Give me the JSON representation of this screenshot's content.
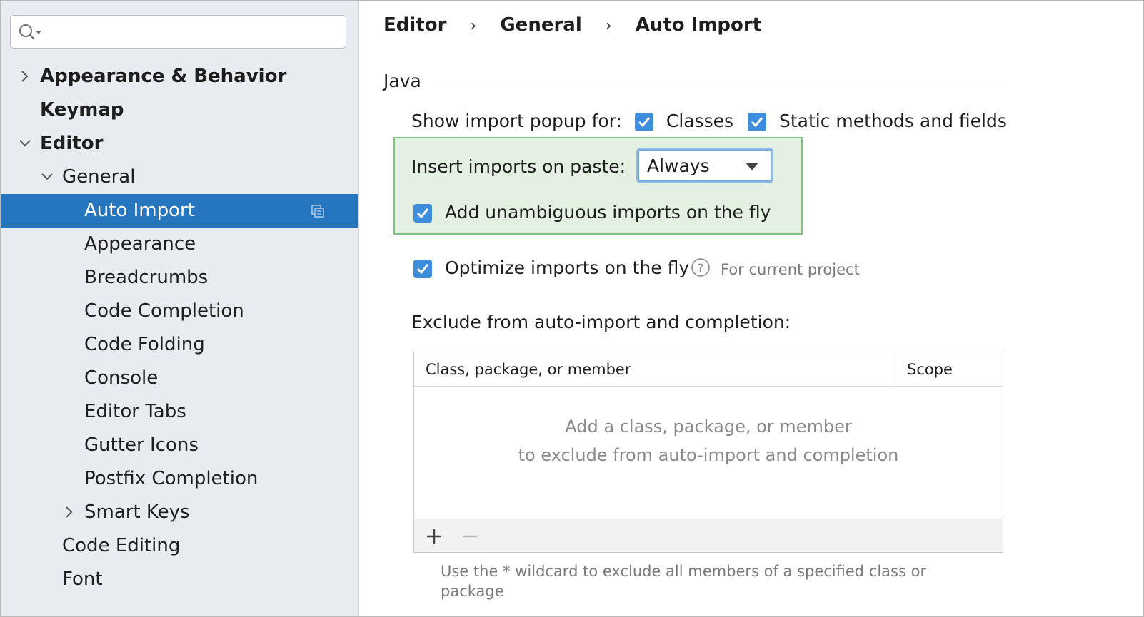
{
  "search": {
    "value": "",
    "placeholder": ""
  },
  "sidebar": {
    "items": [
      {
        "label": "Appearance & Behavior"
      },
      {
        "label": "Keymap"
      },
      {
        "label": "Editor"
      },
      {
        "label": "General"
      },
      {
        "label": "Auto Import"
      },
      {
        "label": "Appearance"
      },
      {
        "label": "Breadcrumbs"
      },
      {
        "label": "Code Completion"
      },
      {
        "label": "Code Folding"
      },
      {
        "label": "Console"
      },
      {
        "label": "Editor Tabs"
      },
      {
        "label": "Gutter Icons"
      },
      {
        "label": "Postfix Completion"
      },
      {
        "label": "Smart Keys"
      },
      {
        "label": "Code Editing"
      },
      {
        "label": "Font"
      }
    ],
    "selected": "Auto Import"
  },
  "breadcrumb": {
    "items": [
      "Editor",
      "General",
      "Auto Import"
    ],
    "separator": "›"
  },
  "java": {
    "section_title": "Java",
    "show_popup_label": "Show import popup for:",
    "classes_label": "Classes",
    "static_label": "Static methods and fields",
    "insert_label": "Insert imports on paste:",
    "insert_value": "Always",
    "unambiguous_label": "Add unambiguous imports on the fly",
    "optimize_label": "Optimize imports on the fly",
    "optimize_hint": "For current project",
    "exclude_label": "Exclude from auto-import and completion:"
  },
  "table": {
    "col_member": "Class, package, or member",
    "col_scope": "Scope",
    "empty_line1": "Add a class, package, or member",
    "empty_line2": "to exclude from auto-import and completion"
  },
  "footnote": "Use the * wildcard to exclude all members of a specified class or package",
  "colors": {
    "accent": "#2675bf",
    "checkbox": "#3e8ddd",
    "highlight_bg": "#e3f0e2",
    "highlight_border": "#7cc57a"
  }
}
